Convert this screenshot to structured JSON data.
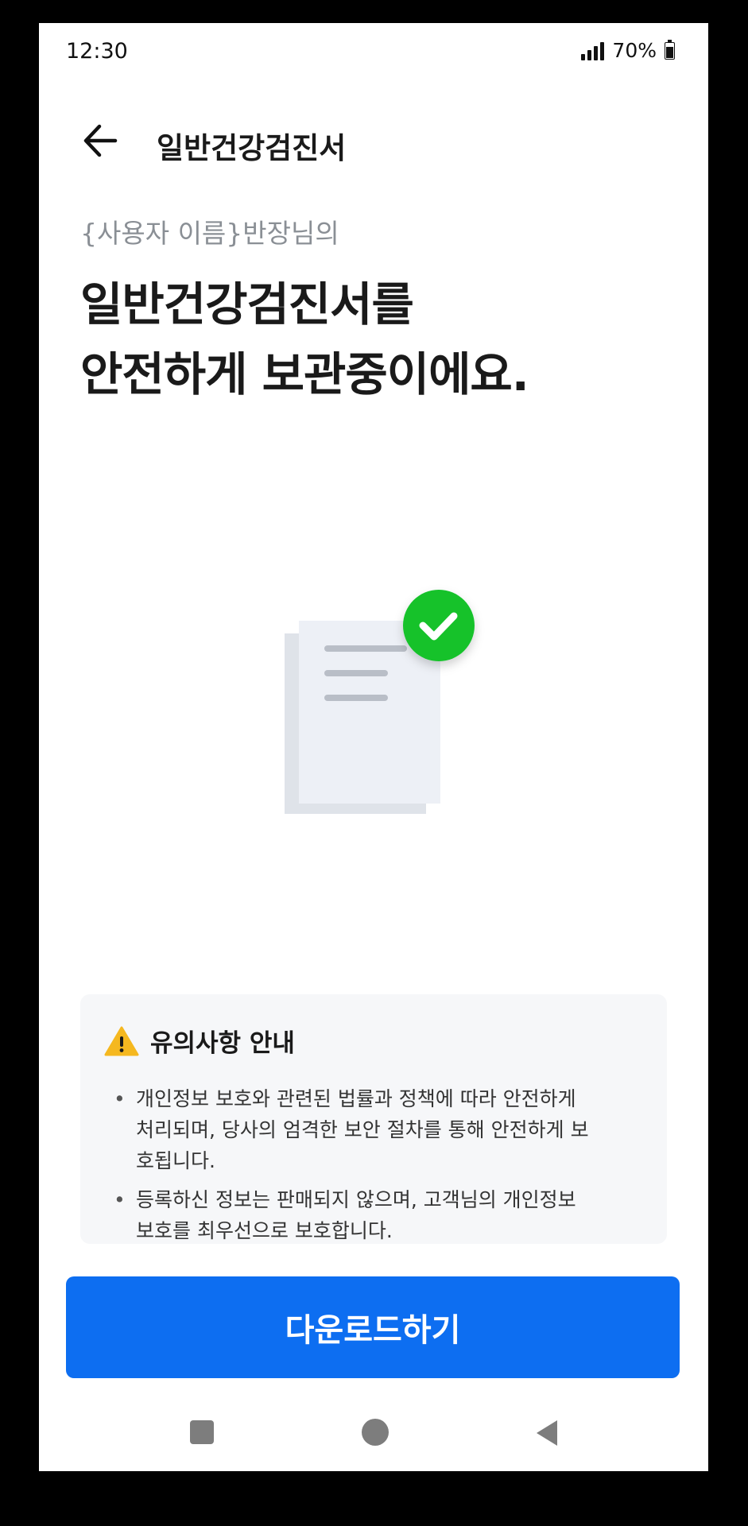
{
  "status_bar": {
    "time": "12:30",
    "battery_text": "70%"
  },
  "header": {
    "title": "일반건강검진서",
    "back_icon": "arrow-left-icon"
  },
  "main": {
    "subtitle": "{사용자 이름}반장님의",
    "headline_line1": "일반건강검진서를",
    "headline_line2": "안전하게 보관중이에요.",
    "illustration_icon": "document-check-icon",
    "check_color": "#12c22b"
  },
  "notice": {
    "icon": "warning-icon",
    "title": "유의사항 안내",
    "items": [
      {
        "line1": "개인정보 보호와 관련된 법률과 정책에 따라 안전하게",
        "line2": "처리되며, 당사의 엄격한 보안 절차를 통해 안전하게 보",
        "line3": "호됩니다."
      },
      {
        "line1": "등록하신 정보는 판매되지 않으며, 고객님의 개인정보",
        "line2": "보호를 최우선으로 보호합니다."
      }
    ]
  },
  "actions": {
    "download_label": "다운로드하기",
    "button_color": "#0d6ef1"
  }
}
